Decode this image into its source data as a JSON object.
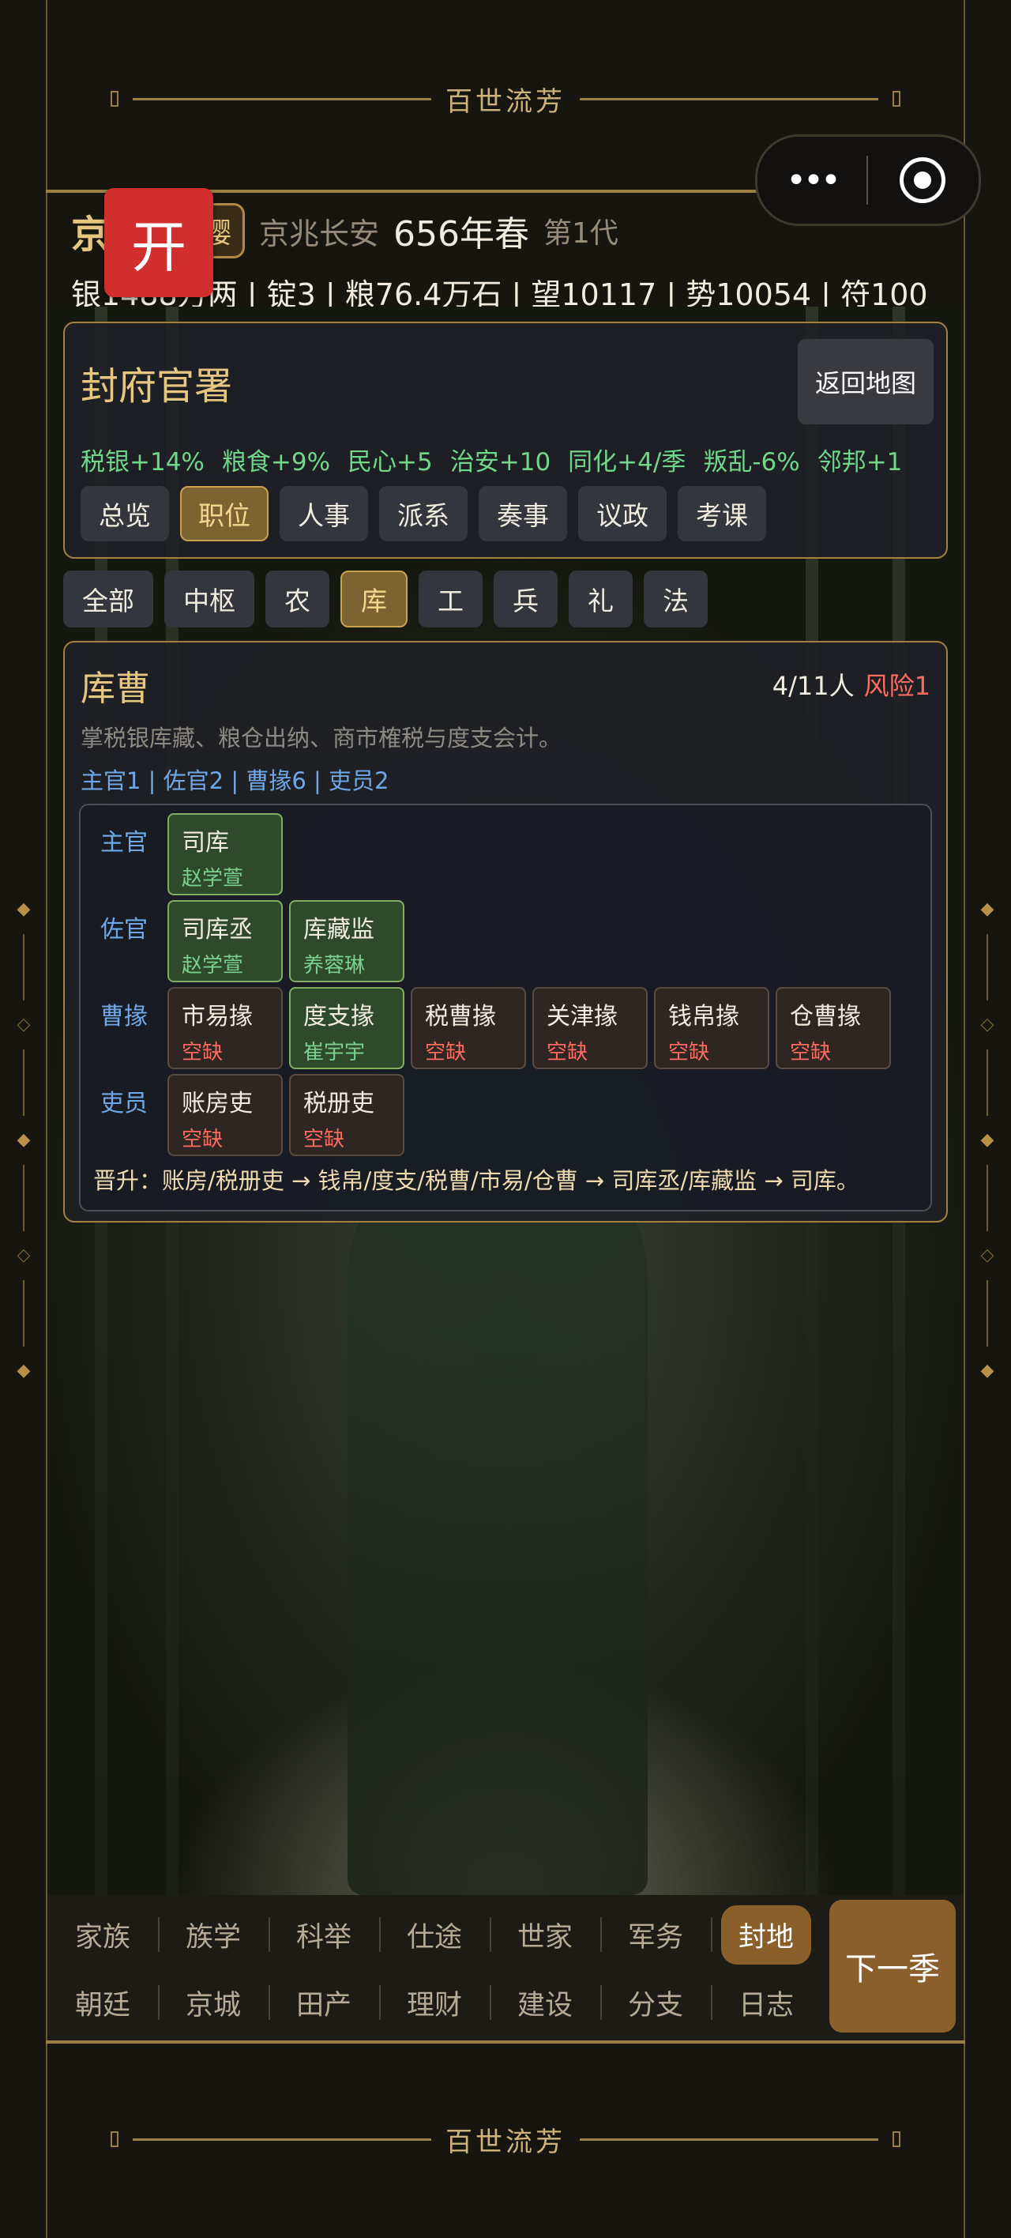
{
  "banner": {
    "title": "百世流芳"
  },
  "capsule": {
    "more_icon": "more-dots-icon",
    "target_icon": "target-icon"
  },
  "kai_button": {
    "label": "开"
  },
  "header": {
    "clan_name": "京氏",
    "badge": "簪缨",
    "location": "京兆长安",
    "season": "656年春",
    "generation": "第1代",
    "resources": "银1488万两 | 锭3 | 粮76.4万石 | 望10117 | 势10054 | 符100"
  },
  "office": {
    "title": "封府官署",
    "back_label": "返回地图",
    "effects": [
      "税银+14%",
      "粮食+9%",
      "民心+5",
      "治安+10",
      "同化+4/季",
      "叛乱-6%",
      "邻邦+1"
    ],
    "tabs": [
      "总览",
      "职位",
      "人事",
      "派系",
      "奏事",
      "议政",
      "考课"
    ],
    "active_tab": "职位"
  },
  "categories": {
    "items": [
      "全部",
      "中枢",
      "农",
      "库",
      "工",
      "兵",
      "礼",
      "法"
    ],
    "active": "库"
  },
  "department": {
    "title": "库曹",
    "count": "4/11人",
    "risk": "风险1",
    "description": "掌税银库藏、粮仓出纳、商市榷税与度支会计。",
    "summary": "主官1 | 佐官2 | 曹掾6 | 吏员2",
    "ranks": [
      {
        "label": "主官",
        "slots": [
          {
            "post": "司库",
            "holder": "赵学萱",
            "filled": true
          }
        ]
      },
      {
        "label": "佐官",
        "slots": [
          {
            "post": "司库丞",
            "holder": "赵学萱",
            "filled": true
          },
          {
            "post": "库藏监",
            "holder": "养蓉琳",
            "filled": true
          }
        ]
      },
      {
        "label": "曹掾",
        "slots": [
          {
            "post": "市易掾",
            "holder": "空缺",
            "filled": false
          },
          {
            "post": "度支掾",
            "holder": "崔宇宇",
            "filled": true
          },
          {
            "post": "税曹掾",
            "holder": "空缺",
            "filled": false
          },
          {
            "post": "关津掾",
            "holder": "空缺",
            "filled": false
          },
          {
            "post": "钱帛掾",
            "holder": "空缺",
            "filled": false
          },
          {
            "post": "仓曹掾",
            "holder": "空缺",
            "filled": false
          }
        ]
      },
      {
        "label": "吏员",
        "slots": [
          {
            "post": "账房吏",
            "holder": "空缺",
            "filled": false
          },
          {
            "post": "税册吏",
            "holder": "空缺",
            "filled": false
          }
        ]
      }
    ],
    "promotion": "晋升：账房/税册吏 → 钱帛/度支/税曹/市易/仓曹 → 司库丞/库藏监 → 司库。"
  },
  "nav": {
    "row1": [
      "家族",
      "族学",
      "科举",
      "仕途",
      "世家",
      "军务",
      "封地"
    ],
    "row2": [
      "朝廷",
      "京城",
      "田产",
      "理财",
      "建设",
      "分支",
      "日志"
    ],
    "active": "封地",
    "next_label": "下一季"
  }
}
